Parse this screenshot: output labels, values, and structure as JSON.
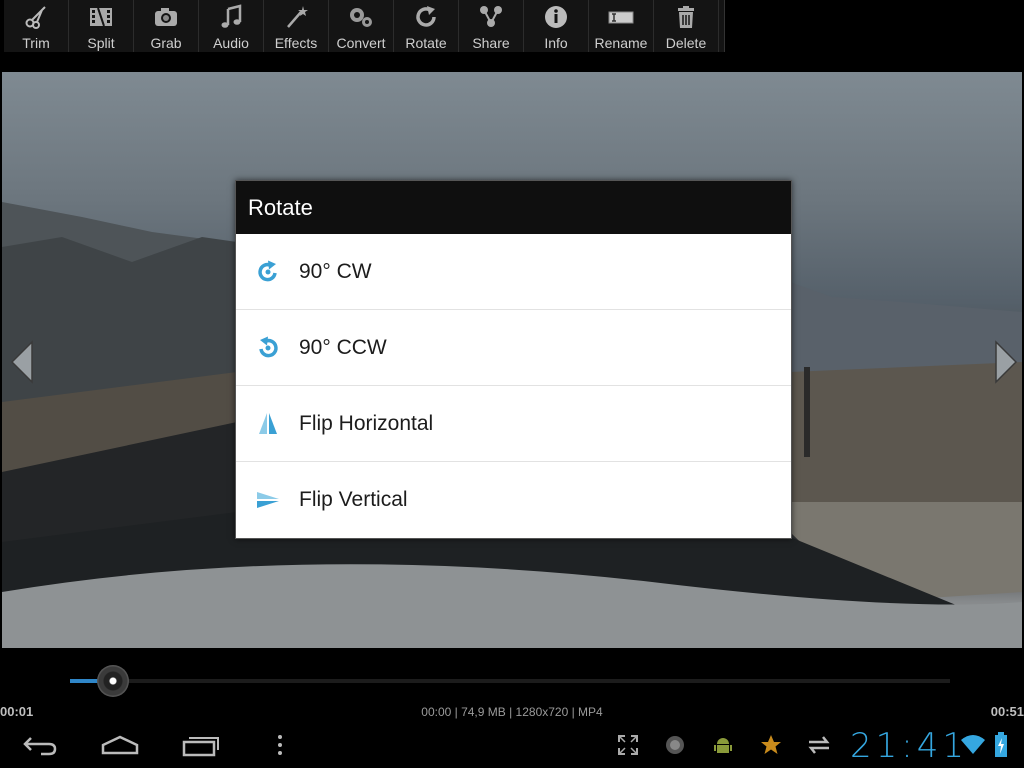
{
  "toolbar": {
    "items": [
      {
        "label": "Trim",
        "icon": "scissors-icon"
      },
      {
        "label": "Split",
        "icon": "film-split-icon"
      },
      {
        "label": "Grab",
        "icon": "camera-icon"
      },
      {
        "label": "Audio",
        "icon": "music-note-icon"
      },
      {
        "label": "Effects",
        "icon": "magic-wand-icon"
      },
      {
        "label": "Convert",
        "icon": "gears-icon"
      },
      {
        "label": "Rotate",
        "icon": "rotate-icon"
      },
      {
        "label": "Share",
        "icon": "share-icon"
      },
      {
        "label": "Info",
        "icon": "info-icon"
      },
      {
        "label": "Rename",
        "icon": "rename-icon"
      },
      {
        "label": "Delete",
        "icon": "trash-icon"
      }
    ]
  },
  "dialog": {
    "title": "Rotate",
    "items": [
      {
        "label": "90° CW",
        "icon": "rotate-cw-icon"
      },
      {
        "label": "90° CCW",
        "icon": "rotate-ccw-icon"
      },
      {
        "label": "Flip Horizontal",
        "icon": "flip-horizontal-icon"
      },
      {
        "label": "Flip Vertical",
        "icon": "flip-vertical-icon"
      }
    ]
  },
  "player": {
    "current_time": "00:01",
    "total_time": "00:51",
    "meta": "00:00 | 74,9 MB | 1280x720 | MP4",
    "progress_fraction": 0.04
  },
  "status": {
    "clock": "21:41"
  },
  "colors": {
    "accent": "#35a7e0",
    "toolbar_bg": "#141414",
    "dialog_title_bg": "#0f0f0f"
  }
}
